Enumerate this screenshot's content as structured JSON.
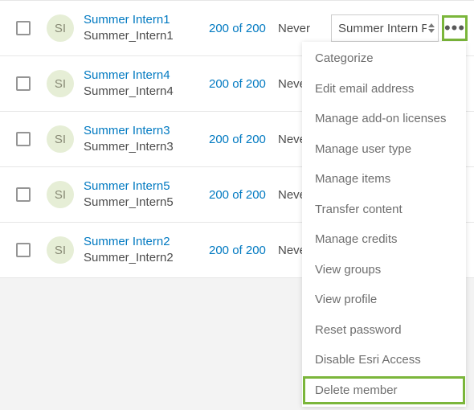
{
  "role_selected": "Summer Intern Pu",
  "avatar_initials": "SI",
  "rows": [
    {
      "display": "Summer Intern1",
      "user": "Summer_Intern1",
      "credits": "200 of 200",
      "last": "Never"
    },
    {
      "display": "Summer Intern4",
      "user": "Summer_Intern4",
      "credits": "200 of 200",
      "last": "Never"
    },
    {
      "display": "Summer Intern3",
      "user": "Summer_Intern3",
      "credits": "200 of 200",
      "last": "Never"
    },
    {
      "display": "Summer Intern5",
      "user": "Summer_Intern5",
      "credits": "200 of 200",
      "last": "Never"
    },
    {
      "display": "Summer Intern2",
      "user": "Summer_Intern2",
      "credits": "200 of 200",
      "last": "Never"
    }
  ],
  "menu": [
    "Categorize",
    "Edit email address",
    "Manage add-on licenses",
    "Manage user type",
    "Manage items",
    "Transfer content",
    "Manage credits",
    "View groups",
    "View profile",
    "Reset password",
    "Disable Esri Access",
    "Delete member"
  ],
  "menu_highlight_index": 11
}
